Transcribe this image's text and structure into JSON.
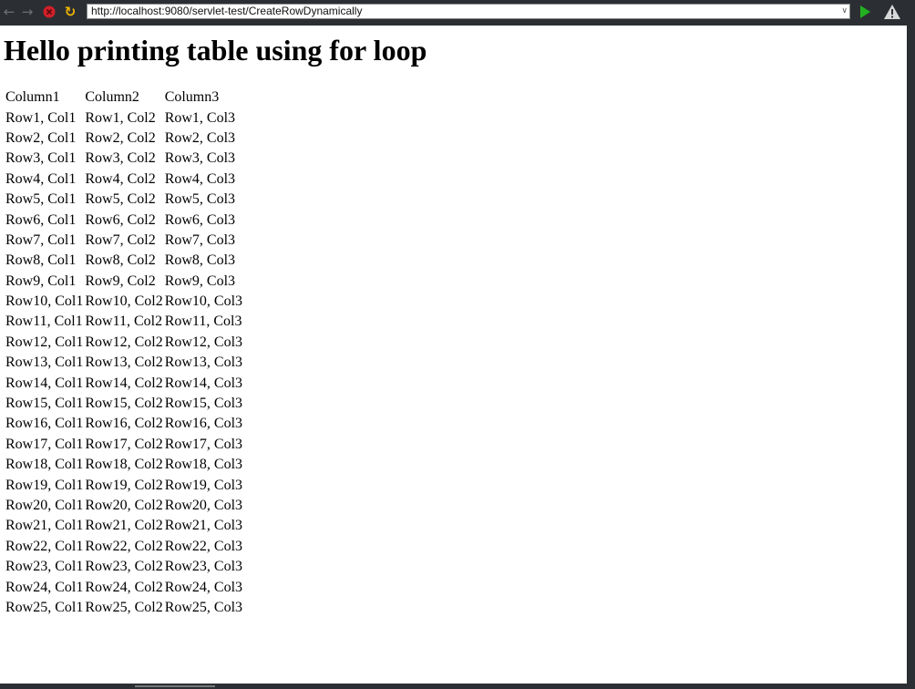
{
  "browser": {
    "url": "http://localhost:9080/servlet-test/CreateRowDynamically",
    "icons": [
      "back-icon",
      "forward-icon",
      "stop-icon",
      "refresh-icon",
      "go-icon",
      "warning-icon"
    ]
  },
  "page": {
    "heading": "Hello printing table using for loop",
    "table": {
      "headers": [
        "Column1",
        "Column2",
        "Column3"
      ],
      "rows": [
        [
          "Row1, Col1",
          "Row1, Col2",
          "Row1, Col3"
        ],
        [
          "Row2, Col1",
          "Row2, Col2",
          "Row2, Col3"
        ],
        [
          "Row3, Col1",
          "Row3, Col2",
          "Row3, Col3"
        ],
        [
          "Row4, Col1",
          "Row4, Col2",
          "Row4, Col3"
        ],
        [
          "Row5, Col1",
          "Row5, Col2",
          "Row5, Col3"
        ],
        [
          "Row6, Col1",
          "Row6, Col2",
          "Row6, Col3"
        ],
        [
          "Row7, Col1",
          "Row7, Col2",
          "Row7, Col3"
        ],
        [
          "Row8, Col1",
          "Row8, Col2",
          "Row8, Col3"
        ],
        [
          "Row9, Col1",
          "Row9, Col2",
          "Row9, Col3"
        ],
        [
          "Row10, Col1",
          "Row10, Col2",
          "Row10, Col3"
        ],
        [
          "Row11, Col1",
          "Row11, Col2",
          "Row11, Col3"
        ],
        [
          "Row12, Col1",
          "Row12, Col2",
          "Row12, Col3"
        ],
        [
          "Row13, Col1",
          "Row13, Col2",
          "Row13, Col3"
        ],
        [
          "Row14, Col1",
          "Row14, Col2",
          "Row14, Col3"
        ],
        [
          "Row15, Col1",
          "Row15, Col2",
          "Row15, Col3"
        ],
        [
          "Row16, Col1",
          "Row16, Col2",
          "Row16, Col3"
        ],
        [
          "Row17, Col1",
          "Row17, Col2",
          "Row17, Col3"
        ],
        [
          "Row18, Col1",
          "Row18, Col2",
          "Row18, Col3"
        ],
        [
          "Row19, Col1",
          "Row19, Col2",
          "Row19, Col3"
        ],
        [
          "Row20, Col1",
          "Row20, Col2",
          "Row20, Col3"
        ],
        [
          "Row21, Col1",
          "Row21, Col2",
          "Row21, Col3"
        ],
        [
          "Row22, Col1",
          "Row22, Col2",
          "Row22, Col3"
        ],
        [
          "Row23, Col1",
          "Row23, Col2",
          "Row23, Col3"
        ],
        [
          "Row24, Col1",
          "Row24, Col2",
          "Row24, Col3"
        ],
        [
          "Row25, Col1",
          "Row25, Col2",
          "Row25, Col3"
        ]
      ]
    }
  }
}
